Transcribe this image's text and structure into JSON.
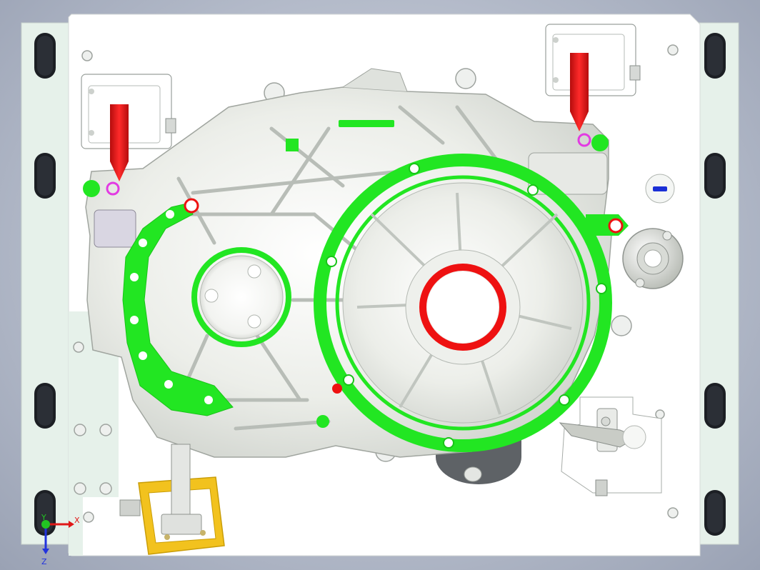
{
  "viewer": {
    "background_top": "#b3bac9",
    "plate_color": "#e6f1ea",
    "gasket_color": "#22e622",
    "seal_color": "#ee1111",
    "arrow_color": "#ee1111",
    "clamp_color": "#f2c21e",
    "marker_color": "#1a2fd6"
  },
  "axis_triad": {
    "x_label": "X",
    "y_label": "Y",
    "z_label": "Z",
    "x_color": "#e01818",
    "y_color": "#22c422",
    "z_color": "#2233dd"
  },
  "icons": [
    "axis-triad-icon",
    "locator-arrow-icon",
    "slot-hole-icon"
  ]
}
